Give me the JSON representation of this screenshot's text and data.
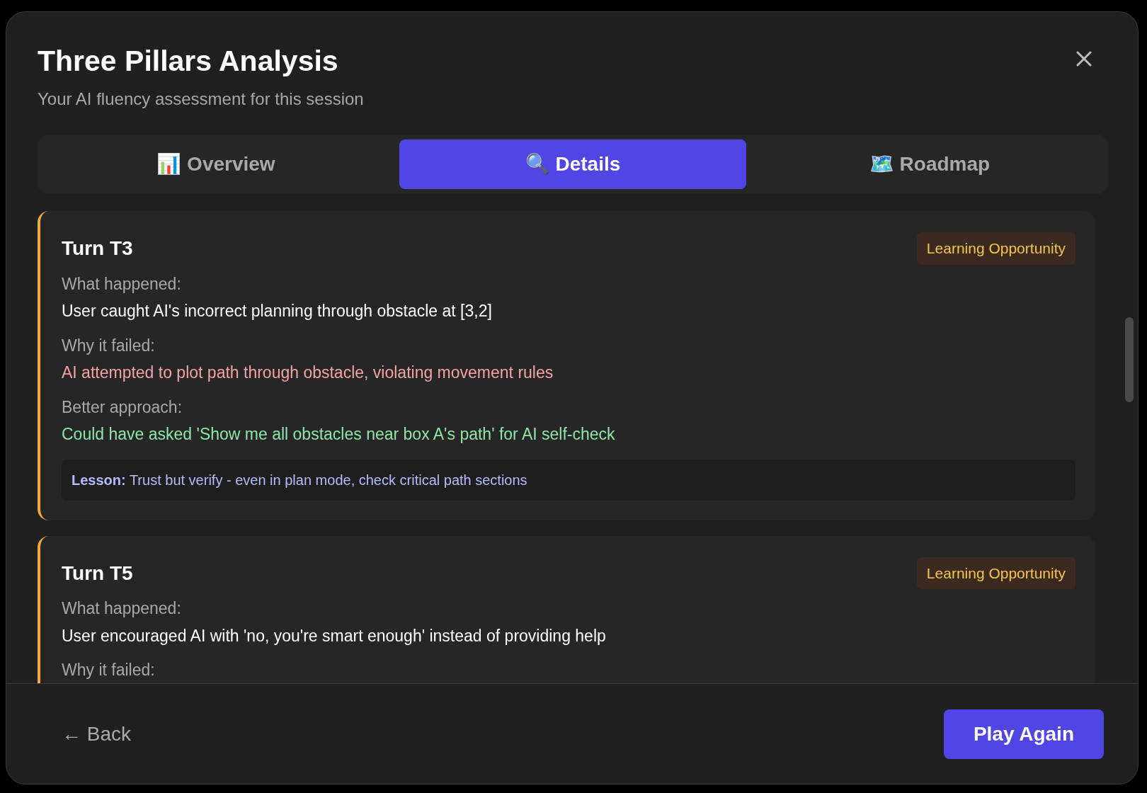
{
  "dialog": {
    "title": "Three Pillars Analysis",
    "subtitle": "Your AI fluency assessment for this session"
  },
  "tabs": [
    {
      "label": "📊 Overview",
      "selected": false
    },
    {
      "label": "🔍 Details",
      "selected": true
    },
    {
      "label": "🗺️ Roadmap",
      "selected": false
    }
  ],
  "turns": [
    {
      "title": "Turn T3",
      "badge": "Learning Opportunity",
      "sections": [
        {
          "kind": "neutral",
          "label": "What happened:",
          "text": "User caught AI's incorrect planning through obstacle at [3,2]"
        },
        {
          "kind": "failure",
          "label": "Why it failed:",
          "text": "AI attempted to plot path through obstacle, violating movement rules"
        },
        {
          "kind": "better",
          "label": "Better approach:",
          "text": "Could have asked 'Show me all obstacles near box A's path' for AI self-check"
        }
      ],
      "lesson": {
        "label": "Lesson:",
        "text": "Trust but verify - even in plan mode, check critical path sections"
      }
    },
    {
      "title": "Turn T5",
      "badge": "Learning Opportunity",
      "sections": [
        {
          "kind": "neutral",
          "label": "What happened:",
          "text": "User encouraged AI with 'no, you're smart enough' instead of providing help"
        },
        {
          "label": "Why it failed:"
        }
      ]
    }
  ],
  "footer": {
    "back": "← Back",
    "primary": "Play Again"
  }
}
